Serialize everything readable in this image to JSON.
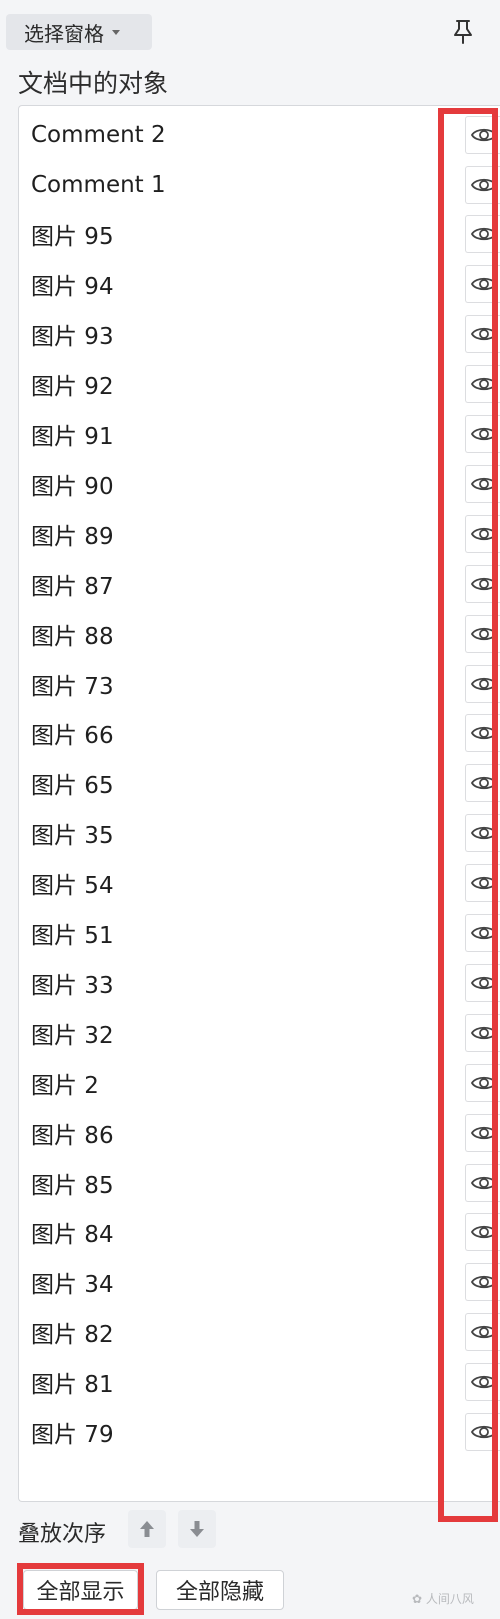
{
  "header": {
    "title": "选择窗格",
    "pin_icon": "pin-icon"
  },
  "section_label": "文档中的对象",
  "objects": [
    {
      "name": "Comment 2",
      "visible": true
    },
    {
      "name": "Comment 1",
      "visible": true
    },
    {
      "name": "图片 95",
      "visible": true
    },
    {
      "name": "图片 94",
      "visible": true
    },
    {
      "name": "图片 93",
      "visible": true
    },
    {
      "name": "图片 92",
      "visible": true
    },
    {
      "name": "图片 91",
      "visible": true
    },
    {
      "name": "图片 90",
      "visible": true
    },
    {
      "name": "图片 89",
      "visible": true
    },
    {
      "name": "图片 87",
      "visible": true
    },
    {
      "name": "图片 88",
      "visible": true
    },
    {
      "name": "图片 73",
      "visible": true
    },
    {
      "name": "图片 66",
      "visible": true
    },
    {
      "name": "图片 65",
      "visible": true
    },
    {
      "name": "图片 35",
      "visible": true
    },
    {
      "name": "图片 54",
      "visible": true
    },
    {
      "name": "图片 51",
      "visible": true
    },
    {
      "name": "图片 33",
      "visible": true
    },
    {
      "name": "图片 32",
      "visible": true
    },
    {
      "name": "图片 2",
      "visible": true
    },
    {
      "name": "图片 86",
      "visible": true
    },
    {
      "name": "图片 85",
      "visible": true
    },
    {
      "name": "图片 84",
      "visible": true
    },
    {
      "name": "图片 34",
      "visible": true
    },
    {
      "name": "图片 82",
      "visible": true
    },
    {
      "name": "图片 81",
      "visible": true
    },
    {
      "name": "图片 79",
      "visible": true
    }
  ],
  "order": {
    "label": "叠放次序",
    "up_icon": "arrow-up-icon",
    "down_icon": "arrow-down-icon"
  },
  "buttons": {
    "show_all": "全部显示",
    "hide_all": "全部隐藏"
  },
  "watermark": "人间八风",
  "colors": {
    "highlight": "#e43a3c",
    "background": "#f4f5f7",
    "list_background": "#ffffff"
  }
}
